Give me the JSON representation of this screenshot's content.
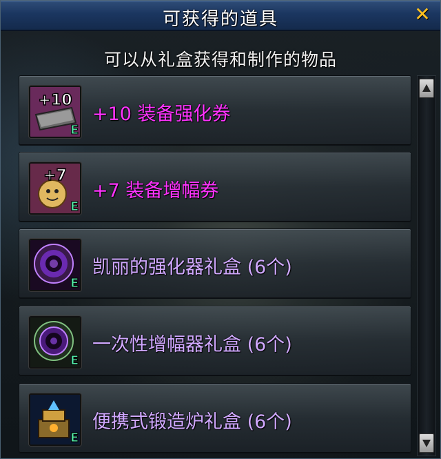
{
  "window": {
    "title": "可获得的道具",
    "close_label": "✕"
  },
  "subtitle": "可以从礼盒获得和制作的物品",
  "items": [
    {
      "label": "+10 装备强化券",
      "color": "#ff33ff",
      "icon": "upgrade-ticket-plus10-icon",
      "badge": "+10"
    },
    {
      "label": "+7 装备增幅券",
      "color": "#ff33ff",
      "icon": "amplify-ticket-plus7-icon",
      "badge": "+7"
    },
    {
      "label": "凯丽的强化器礼盒 (6个)",
      "color": "#d0a8ff",
      "icon": "kelly-enhancer-box-icon"
    },
    {
      "label": "一次性增幅器礼盒 (6个)",
      "color": "#d0a8ff",
      "icon": "amplifier-box-icon"
    },
    {
      "label": "便携式锻造炉礼盒 (6个)",
      "color": "#d0a8ff",
      "icon": "forge-box-icon"
    }
  ],
  "colors": {
    "title_bar": "#1b3660",
    "close": "#ffc020",
    "item_text_special": "#ff33ff",
    "item_text_box": "#d0a8ff"
  }
}
